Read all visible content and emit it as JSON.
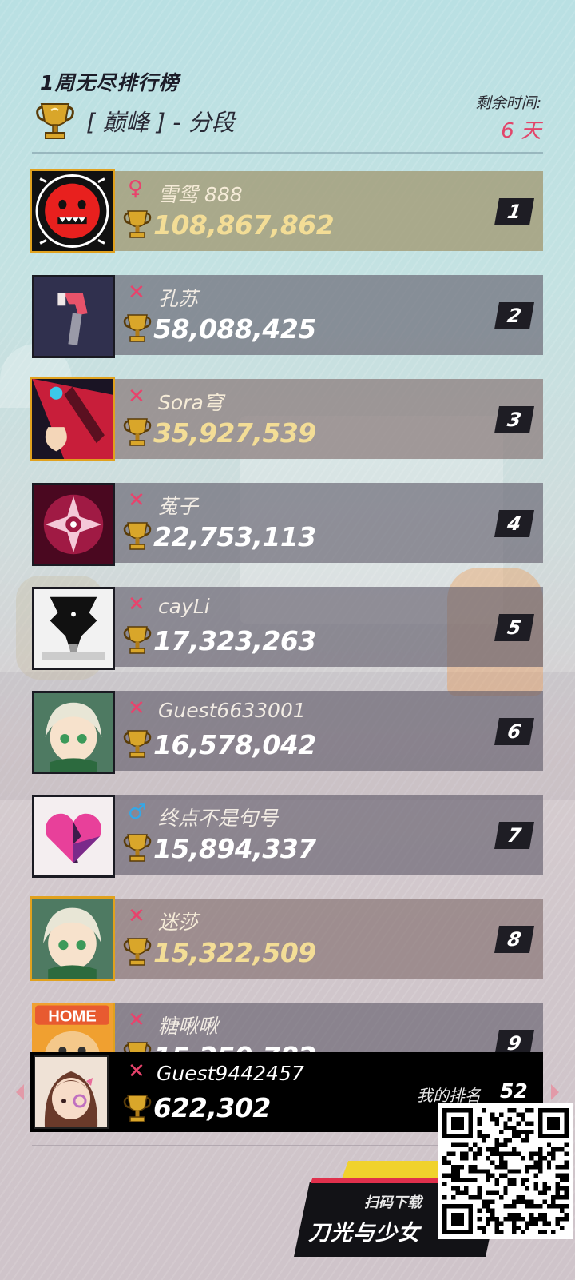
{
  "header": {
    "title": "1周无尽排行榜",
    "tier": "[ 巅峰 ] - 分段",
    "remaining_label": "剩余时间:",
    "remaining_value": "6 天"
  },
  "leaderboard": [
    {
      "rank": "1",
      "name": "雪鸳 888",
      "score": "108,867,862",
      "gender": "♀",
      "gender_type": "female",
      "style": "first"
    },
    {
      "rank": "2",
      "name": "孔苏",
      "score": "58,088,425",
      "gender": "✕",
      "gender_type": "none",
      "style": "normal"
    },
    {
      "rank": "3",
      "name": "Sora穹",
      "score": "35,927,539",
      "gender": "✕",
      "gender_type": "none",
      "style": "brown"
    },
    {
      "rank": "4",
      "name": "菟子",
      "score": "22,753,113",
      "gender": "✕",
      "gender_type": "none",
      "style": "normal"
    },
    {
      "rank": "5",
      "name": "cayLi",
      "score": "17,323,263",
      "gender": "✕",
      "gender_type": "none",
      "style": "normal"
    },
    {
      "rank": "6",
      "name": "Guest6633001",
      "score": "16,578,042",
      "gender": "✕",
      "gender_type": "none",
      "style": "normal"
    },
    {
      "rank": "7",
      "name": "终点不是句号",
      "score": "15,894,337",
      "gender": "♂",
      "gender_type": "male",
      "style": "normal"
    },
    {
      "rank": "8",
      "name": "迷莎",
      "score": "15,322,509",
      "gender": "✕",
      "gender_type": "none",
      "style": "brown"
    },
    {
      "rank": "9",
      "name": "糖啾啾",
      "score": "15,259,782",
      "gender": "✕",
      "gender_type": "none",
      "style": "normal"
    }
  ],
  "my_entry": {
    "name": "Guest9442457",
    "score": "622,302",
    "gender": "✕",
    "rank_label": "我的排名",
    "rank_value": "52"
  },
  "promo": {
    "scan_text": "扫码下载",
    "game_name": "刀光与少女"
  },
  "colors": {
    "accent_red": "#e2456a",
    "gold": "#e0a11e",
    "male_blue": "#33a8e8"
  }
}
